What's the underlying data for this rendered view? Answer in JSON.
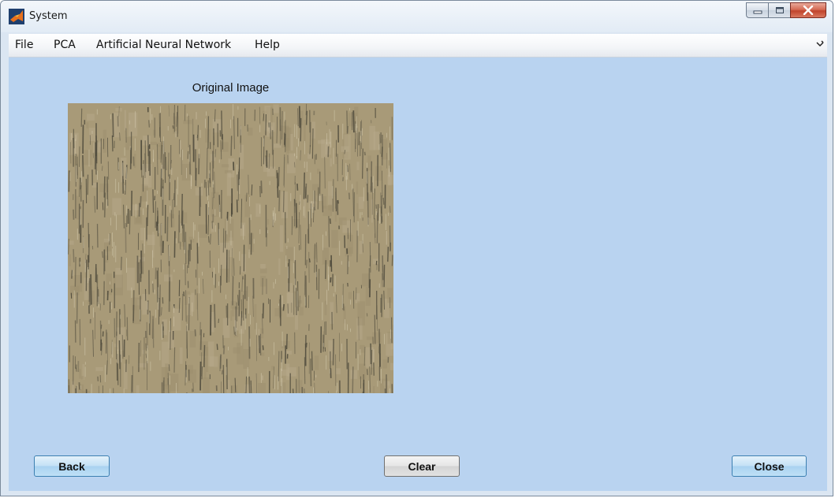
{
  "window": {
    "title": "System"
  },
  "menubar": {
    "items": [
      "File",
      "PCA",
      "Artificial Neural Network",
      "Help"
    ],
    "overflow_icon": "arrow-icon"
  },
  "axes": {
    "title": "Original Image",
    "image_description_icon": "texture-image"
  },
  "buttons": {
    "back": "Back",
    "clear": "Clear",
    "close": "Close"
  },
  "colors": {
    "figure_background": "#b9d3f0",
    "texture_base": "#a89a78"
  }
}
